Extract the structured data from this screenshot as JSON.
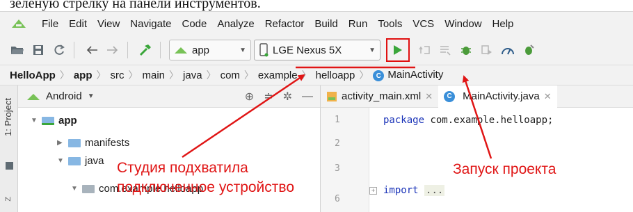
{
  "caption": "зеленую стрелку на панели инструментов.",
  "menu": {
    "items": [
      "File",
      "Edit",
      "View",
      "Navigate",
      "Code",
      "Analyze",
      "Refactor",
      "Build",
      "Run",
      "Tools",
      "VCS",
      "Window",
      "Help"
    ]
  },
  "toolbar": {
    "app_config": "app",
    "device": "LGE Nexus 5X"
  },
  "breadcrumb": {
    "items": [
      "HelloApp",
      "app",
      "src",
      "main",
      "java",
      "com",
      "example",
      "helloapp",
      "MainActivity"
    ]
  },
  "project_panel": {
    "side_tab": "1: Project",
    "side_tab2": "Z",
    "view_mode": "Android",
    "tree": [
      "app",
      "manifests",
      "java",
      "com.example.helloapp"
    ]
  },
  "editor": {
    "tabs": [
      "activity_main.xml",
      "MainActivity.java"
    ],
    "line_numbers": [
      "1",
      "2",
      "3",
      "6"
    ],
    "line1_keyword": "package",
    "line1_rest": " com.example.helloapp;",
    "line3_keyword": "import",
    "line3_rest": "..."
  },
  "annotations": {
    "device_note_line1": "Студия подхватила",
    "device_note_line2": "подключенное устройство",
    "run_note": "Запуск проекта"
  },
  "colors": {
    "annotation": "#e01515",
    "run_green": "#3aa63a",
    "android_green": "#78c257",
    "folder_blue": "#87b7e3"
  }
}
